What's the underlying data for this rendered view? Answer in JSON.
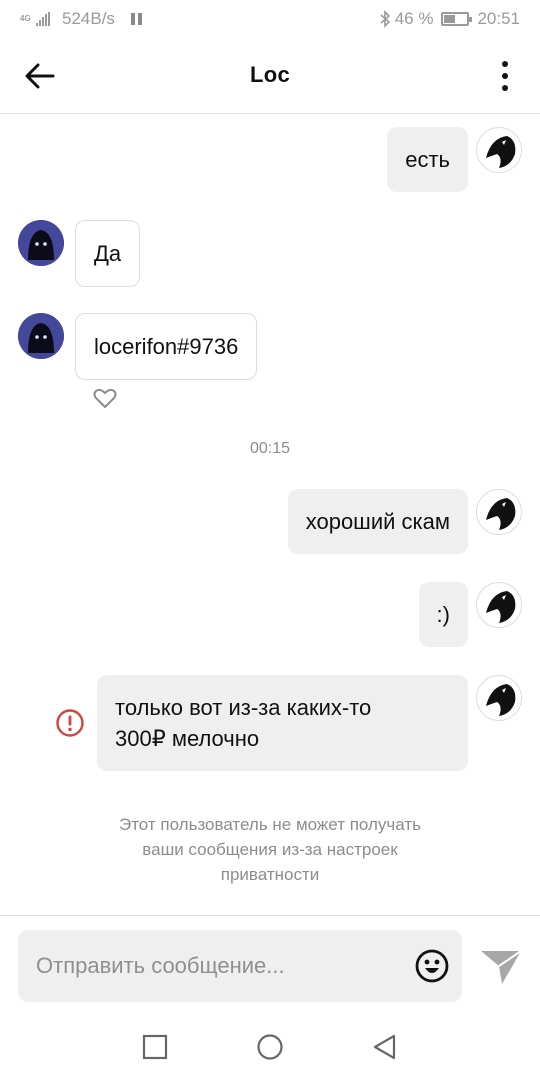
{
  "status_bar": {
    "network": "4G",
    "speed": "524B/s",
    "battery_percent": "46 %",
    "battery_level": 0.46,
    "time": "20:51"
  },
  "header": {
    "title": "Loc",
    "back_icon": "arrow-left-icon",
    "menu_icon": "more-vertical-icon"
  },
  "messages": [
    {
      "text": "есть",
      "direction": "outgoing"
    },
    {
      "text": "Да",
      "direction": "incoming"
    },
    {
      "text": "locerifon#9736",
      "direction": "incoming",
      "reaction_icon": "heart-outline-icon"
    },
    {
      "text": "хороший скам",
      "direction": "outgoing"
    },
    {
      "text": ":)",
      "direction": "outgoing"
    },
    {
      "text_lines": [
        "только вот из-за каких-то",
        "300₽ мелочно"
      ],
      "direction": "outgoing",
      "status_icon": "error-icon"
    }
  ],
  "timestamp": "00:15",
  "notice_lines": [
    "Этот пользователь не может получать",
    "ваши сообщения из-за настроек",
    "приватности"
  ],
  "composer": {
    "placeholder": "Отправить сообщение...",
    "emoji_icon": "emoji-icon",
    "send_icon": "send-icon"
  },
  "navbar": {
    "icons": [
      "recent-apps-icon",
      "home-icon",
      "back-triangle-icon"
    ]
  },
  "colors": {
    "bubble_out": "#efefef",
    "error": "#d0453f",
    "muted_text": "#8c8c8c"
  }
}
